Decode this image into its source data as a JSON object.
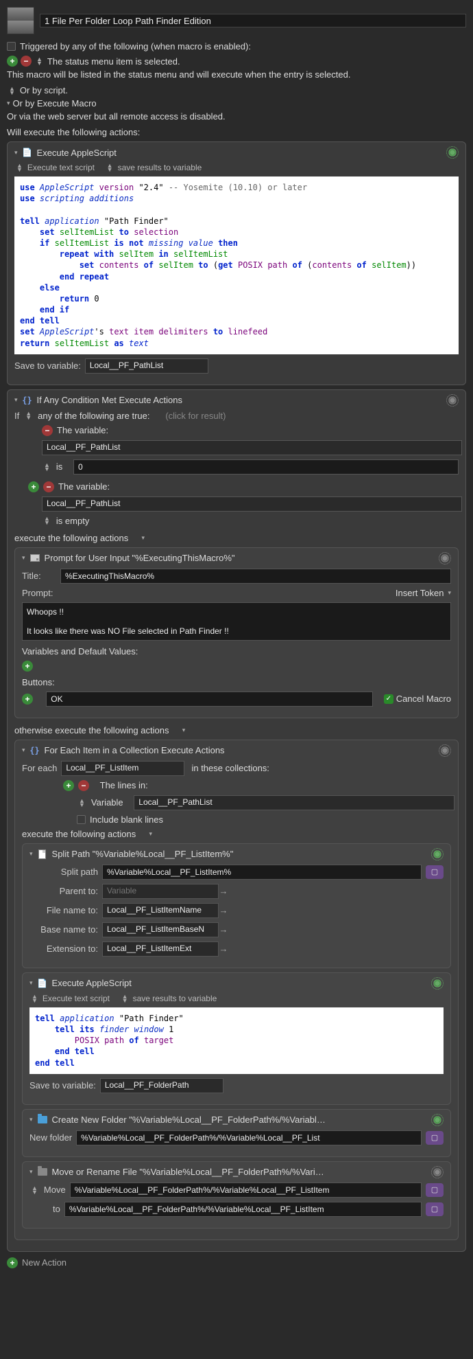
{
  "title": "1 File Per Folder Loop Path Finder Edition",
  "trigger_heading": "Triggered by any of the following (when macro is enabled):",
  "status_item": "The status menu item is selected.",
  "status_desc": "This macro will be listed in the status menu and will execute when the entry is selected.",
  "or_script": "Or by script.",
  "or_exec": "Or by Execute Macro",
  "or_web": "Or via the web server but all remote access is disabled.",
  "will_exec": "Will execute the following actions:",
  "actions": {
    "applescript1": {
      "title": "Execute AppleScript",
      "opt1": "Execute text script",
      "opt2": "save results to variable",
      "save_label": "Save to variable:",
      "save_var": "Local__PF_PathList"
    },
    "if": {
      "title": "If Any Condition Met Execute Actions",
      "if_label": "If",
      "any_label": "any of the following are true:",
      "click_hint": "(click for result)",
      "cond1_label": "The variable:",
      "cond1_var": "Local__PF_PathList",
      "cond1_op": "is",
      "cond1_val": "0",
      "cond2_label": "The variable:",
      "cond2_var": "Local__PF_PathList",
      "cond2_op": "is empty",
      "exec_then": "execute the following actions",
      "otherwise": "otherwise execute the following actions"
    },
    "prompt": {
      "title": "Prompt for User Input \"%ExecutingThisMacro%\"",
      "title_label": "Title:",
      "title_val": "%ExecutingThisMacro%",
      "prompt_label": "Prompt:",
      "insert_token": "Insert Token",
      "prompt_text": "Whoops !!\n\nIt looks like there was NO File selected in Path Finder !!",
      "vars_label": "Variables and Default Values:",
      "buttons_label": "Buttons:",
      "button_ok": "OK",
      "cancel_macro": "Cancel Macro"
    },
    "foreach": {
      "title": "For Each Item in a Collection Execute Actions",
      "for_label": "For each",
      "for_var": "Local__PF_ListItem",
      "in_label": "in these collections:",
      "lines_label": "The lines in:",
      "var_label": "Variable",
      "lines_var": "Local__PF_PathList",
      "blank_label": "Include blank lines",
      "exec_label": "execute the following actions"
    },
    "split": {
      "title": "Split Path \"%Variable%Local__PF_ListItem%\"",
      "split_label": "Split path",
      "split_val": "%Variable%Local__PF_ListItem%",
      "parent_label": "Parent to:",
      "parent_val": "Variable",
      "filename_label": "File name to:",
      "filename_val": "Local__PF_ListItemName",
      "basename_label": "Base name to:",
      "basename_val": "Local__PF_ListItemBaseN",
      "ext_label": "Extension to:",
      "ext_val": "Local__PF_ListItemExt"
    },
    "applescript2": {
      "title": "Execute AppleScript",
      "opt1": "Execute text script",
      "opt2": "save results to variable",
      "save_label": "Save to variable:",
      "save_var": "Local__PF_FolderPath"
    },
    "newfolder": {
      "title": "Create New Folder \"%Variable%Local__PF_FolderPath%/%Variable%Local__…",
      "label": "New folder",
      "val": "%Variable%Local__PF_FolderPath%/%Variable%Local__PF_List"
    },
    "move": {
      "title": "Move or Rename File \"%Variable%Local__PF_FolderPath%/%Variable%Local…",
      "move_label": "Move",
      "move_val": "%Variable%Local__PF_FolderPath%/%Variable%Local__PF_ListItem",
      "to_label": "to",
      "to_val": "%Variable%Local__PF_FolderPath%/%Variable%Local__PF_ListItem"
    }
  },
  "new_action": "New Action"
}
